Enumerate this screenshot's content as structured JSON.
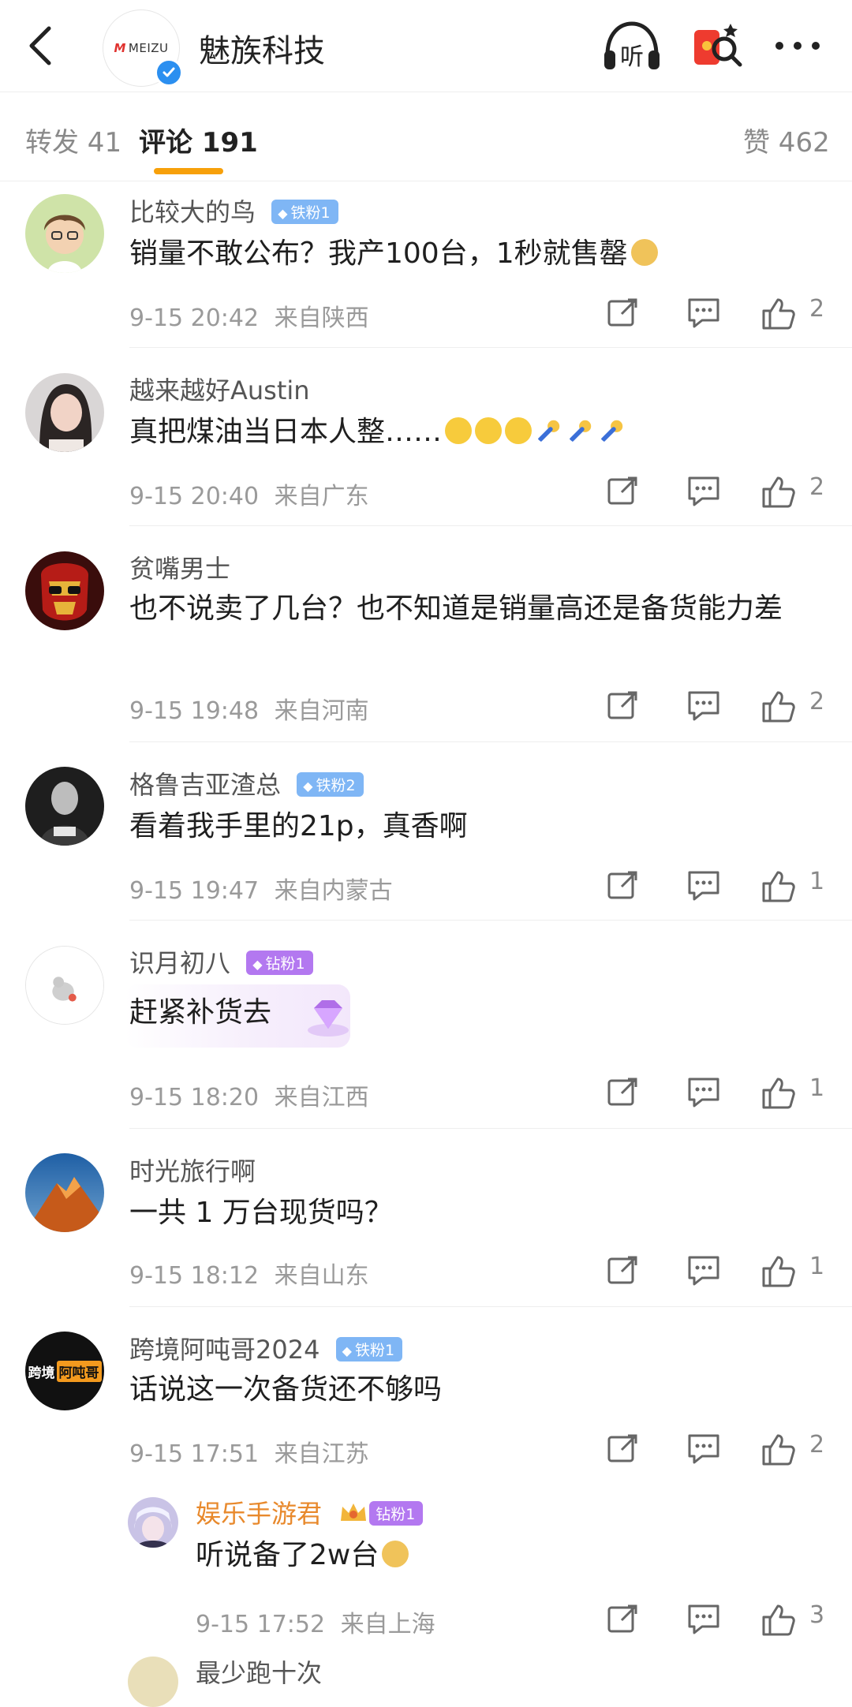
{
  "header": {
    "title": "魅族科技",
    "brand_logo_mark": "M",
    "brand_logo_text": "MEIZU",
    "listen_label": "听"
  },
  "tabs": [
    {
      "label": "转发 41"
    },
    {
      "label": "评论 191"
    },
    {
      "label": "赞 462"
    }
  ],
  "comments": [
    {
      "username": "比较大的鸟",
      "badge": "铁粉1",
      "text": "销量不敢公布？我产100台，1秒就售罄",
      "time": "9-15 20:42",
      "location": "来自陕西",
      "likes": "2"
    },
    {
      "username": "越来越好Austin",
      "badge": "",
      "text": "真把煤油当日本人整……",
      "time": "9-15 20:40",
      "location": "来自广东",
      "likes": "2"
    },
    {
      "username": "贫嘴男士",
      "badge": "",
      "text": "也不说卖了几台？也不知道是销量高还是备货能力差",
      "time": "9-15 19:48",
      "location": "来自河南",
      "likes": "2"
    },
    {
      "username": "格鲁吉亚渣总",
      "badge": "铁粉2",
      "text": "看着我手里的21p，真香啊",
      "time": "9-15 19:47",
      "location": "来自内蒙古",
      "likes": "1"
    },
    {
      "username": "识月初八",
      "badge": "钻粉1",
      "text": "赶紧补货去",
      "time": "9-15 18:20",
      "location": "来自江西",
      "likes": "1"
    },
    {
      "username": "时光旅行啊",
      "badge": "",
      "text": "一共 1 万台现货吗？",
      "time": "9-15 18:12",
      "location": "来自山东",
      "likes": "1"
    },
    {
      "username": "跨境阿吨哥2024",
      "badge": "铁粉1",
      "text": "话说这一次备货还不够吗",
      "time": "9-15 17:51",
      "location": "来自江苏",
      "likes": "2",
      "avatar_text_1": "跨境",
      "avatar_text_2": "阿吨哥"
    },
    {
      "username": "娱乐手游君",
      "badge": "钻粉1",
      "text": "听说备了2w台",
      "time": "9-15 17:52",
      "location": "来自上海",
      "likes": "3"
    },
    {
      "username": "最少跑十次",
      "badge": "",
      "text": "",
      "time": "",
      "location": "",
      "likes": ""
    }
  ],
  "colors": {
    "accent": "#f7a00a",
    "verify": "#2b8ff0",
    "iron_badge": "#7fb6f5",
    "diamond_badge": "#b378f0",
    "gold_name": "#e8892c"
  },
  "icons": [
    "back-arrow-icon",
    "verified-icon",
    "headphones-icon",
    "gift-icon",
    "more-icon",
    "share-icon",
    "reply-icon",
    "like-icon"
  ]
}
